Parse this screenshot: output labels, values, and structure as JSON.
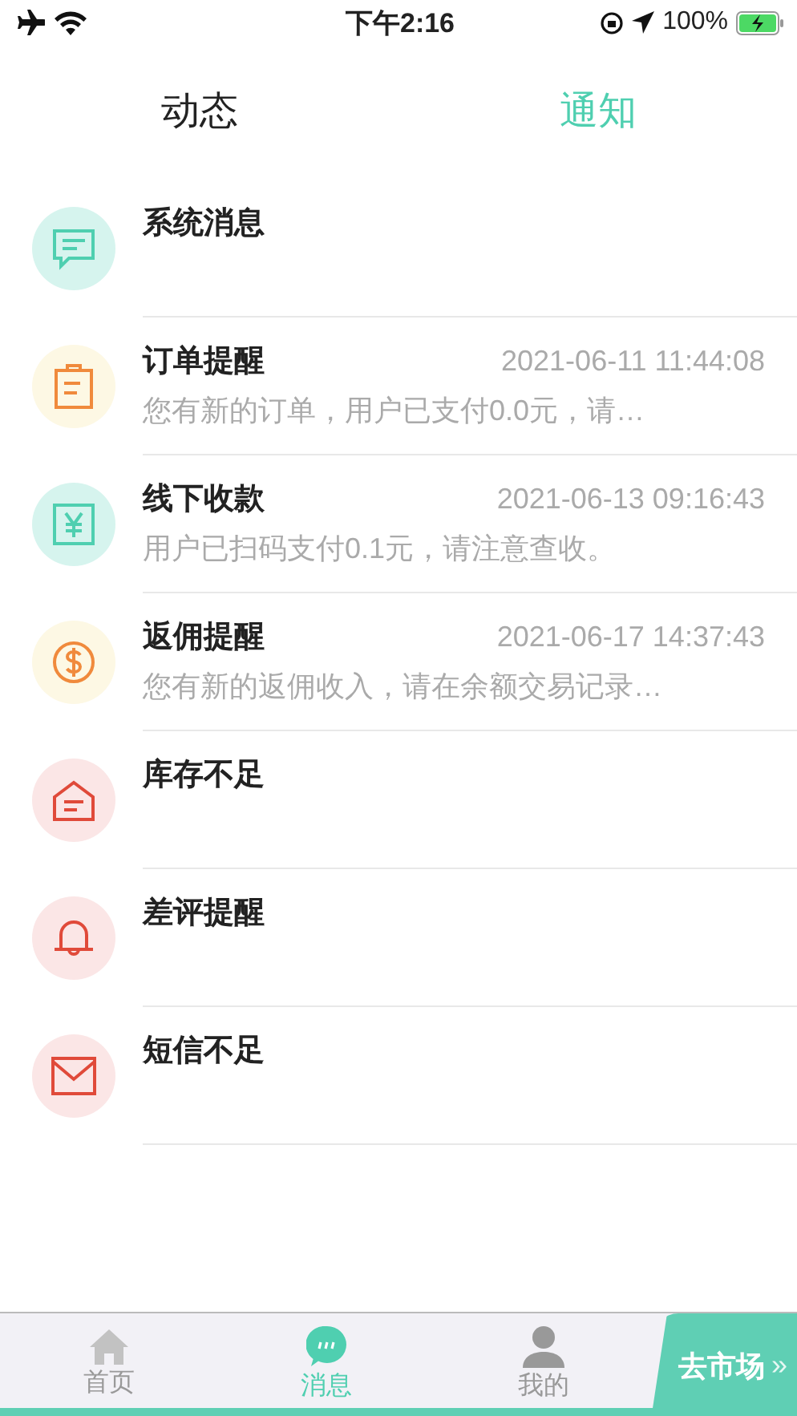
{
  "status_bar": {
    "time": "下午2:16",
    "battery": "100%"
  },
  "tabs": [
    {
      "label": "动态",
      "selected": false
    },
    {
      "label": "通知",
      "selected": true
    }
  ],
  "notifications": [
    {
      "kind": "chat",
      "color": "#4fcfb0",
      "title": "系统消息"
    },
    {
      "kind": "clipboard",
      "color": "#f08a3c",
      "title": "订单提醒",
      "time": "2021-06-11 11:44:08",
      "message": "您有新的订单，用户已支付0.0元，请…"
    },
    {
      "kind": "yen",
      "color": "#4fcfb0",
      "title": "线下收款",
      "time": "2021-06-13 09:16:43",
      "message": "用户已扫码支付0.1元，请注意查收。"
    },
    {
      "kind": "dollar",
      "color": "#f08a3c",
      "title": "返佣提醒",
      "time": "2021-06-17 14:37:43",
      "message": "您有新的返佣收入，请在余额交易记录…"
    },
    {
      "kind": "house",
      "color": "#e04a3a",
      "title": "库存不足"
    },
    {
      "kind": "bell",
      "color": "#e04a3a",
      "title": "差评提醒"
    },
    {
      "kind": "mail",
      "color": "#e04a3a",
      "title": "短信不足"
    }
  ],
  "bottom_nav": [
    {
      "kind": "home",
      "label": "首页",
      "selected": false
    },
    {
      "kind": "chat",
      "label": "消息",
      "selected": true
    },
    {
      "kind": "person",
      "label": "我的",
      "selected": false
    }
  ],
  "market_button": {
    "label": "去市场",
    "arrow": "»"
  }
}
